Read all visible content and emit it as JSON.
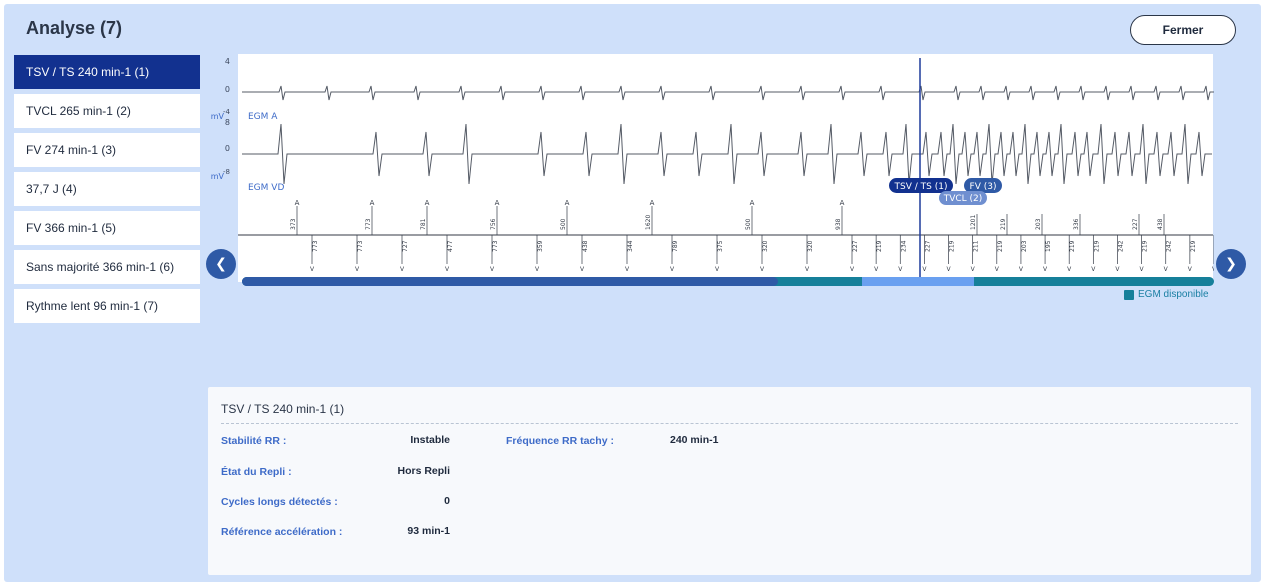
{
  "header": {
    "title": "Analyse (7)",
    "close_label": "Fermer"
  },
  "episodes": [
    {
      "label": "TSV / TS 240 min-1 (1)",
      "active": true
    },
    {
      "label": "TVCL 265 min-1 (2)",
      "active": false
    },
    {
      "label": "FV 274 min-1 (3)",
      "active": false
    },
    {
      "label": "37,7 J (4)",
      "active": false
    },
    {
      "label": "FV 366 min-1 (5)",
      "active": false
    },
    {
      "label": "Sans majorité 366 min-1 (6)",
      "active": false
    },
    {
      "label": "Rythme lent 96 min-1 (7)",
      "active": false
    }
  ],
  "egm": {
    "unit": "mV",
    "channel_a": {
      "label": "EGM A",
      "ticks": [
        "4",
        "0",
        "-4"
      ]
    },
    "channel_vd": {
      "label": "EGM VD",
      "ticks": [
        "8",
        "0",
        "-8"
      ]
    },
    "markers": {
      "tsv": "TSV / TS (1)",
      "fv": "FV (3)",
      "tvcl": "TVCL (2)"
    },
    "a_marker_letter": "A",
    "v_marker_letter": "V",
    "a_marker_numbers": [
      "373",
      "773",
      "781",
      "756",
      "500",
      "1620",
      "500",
      "938"
    ],
    "v_marker_numbers": [
      "773",
      "773",
      "727",
      "477",
      "773",
      "359",
      "438",
      "344",
      "789",
      "375",
      "320",
      "320",
      "227",
      "219",
      "234",
      "227",
      "219",
      "211",
      "219",
      "203",
      "195",
      "219",
      "219",
      "242",
      "219",
      "242",
      "219",
      "219"
    ],
    "a_marker_numbers_late": [
      "1201",
      "219",
      "203",
      "336",
      "227",
      "438"
    ],
    "legend": "EGM disponible",
    "colors": {
      "trace": "#555b66",
      "cursor": "#1f3c9c",
      "timeline_dark": "#2f5aa6",
      "timeline_teal": "#16809a",
      "timeline_highlight": "#6aa0f0"
    }
  },
  "details": {
    "title": "TSV / TS 240 min-1 (1)",
    "stabilite_label": "Stabilité RR :",
    "stabilite_value": "Instable",
    "frequence_label": "Fréquence RR tachy :",
    "frequence_value": "240 min-1",
    "etat_label": "État du Repli :",
    "etat_value": "Hors Repli",
    "cycles_label": "Cycles longs détectés  :",
    "cycles_value": "0",
    "reference_label": "Référence accélération :",
    "reference_value": "93 min-1"
  }
}
